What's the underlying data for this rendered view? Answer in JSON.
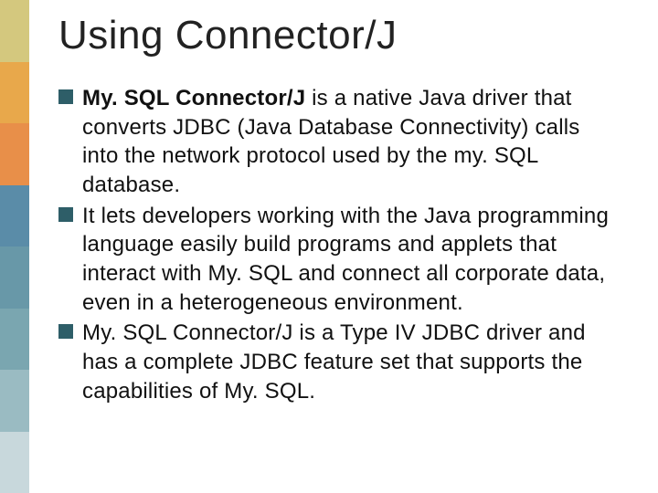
{
  "title": "Using Connector/J",
  "bullets": [
    {
      "bold_prefix": "My. SQL Connector/J",
      "rest": " is a native Java driver that converts JDBC (Java Database Connectivity) calls into the network protocol used by the my. SQL database."
    },
    {
      "bold_prefix": "",
      "rest": " It lets developers working with the Java programming language easily build programs  and applets that interact with My. SQL and connect all corporate data, even in a heterogeneous environment."
    },
    {
      "bold_prefix": "",
      "rest": "My. SQL Connector/J is a Type IV JDBC driver and has a complete JDBC feature set that supports the capabilities of My. SQL."
    }
  ]
}
